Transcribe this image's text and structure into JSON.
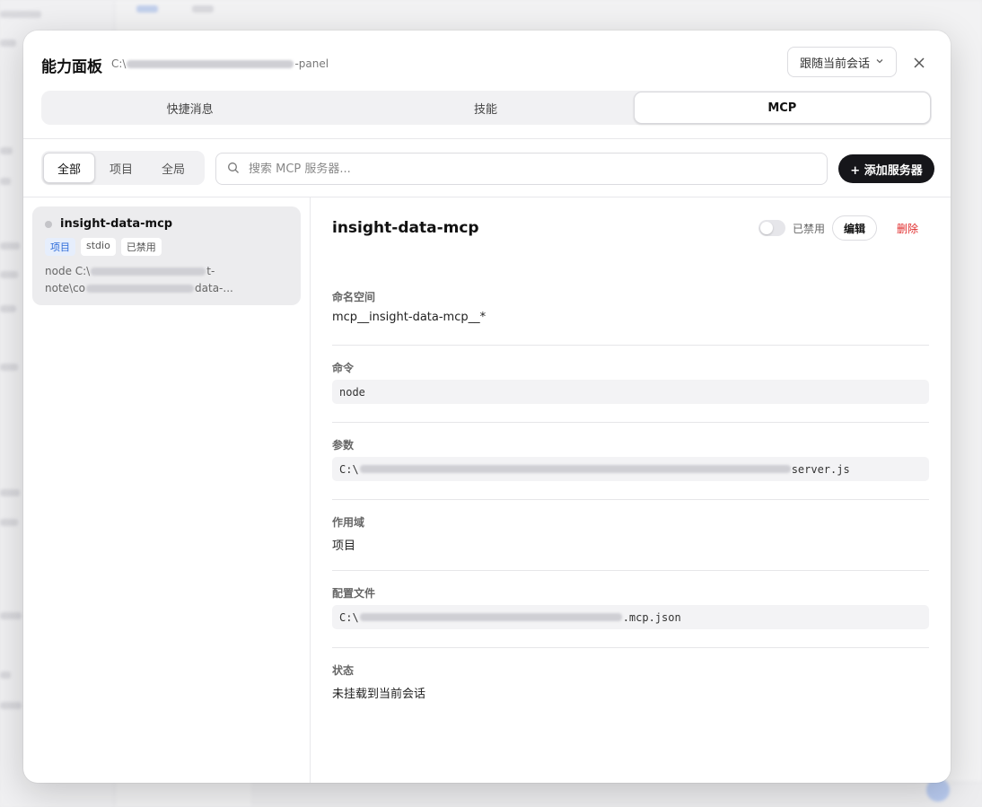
{
  "modal": {
    "title": "能力面板",
    "path_prefix": "C:\\",
    "path_suffix": "-panel",
    "follow_select": "跟随当前会话",
    "close_glyph": "✕"
  },
  "tabs": [
    {
      "label": "快捷消息",
      "active": false
    },
    {
      "label": "技能",
      "active": false
    },
    {
      "label": "MCP",
      "active": true
    }
  ],
  "filter": {
    "segments": [
      "全部",
      "项目",
      "全局"
    ],
    "active": "全部",
    "search_placeholder": "搜索 MCP 服务器...",
    "add_button": "+ 添加服务器"
  },
  "server_list": [
    {
      "name": "insight-data-mcp",
      "badges": [
        "项目",
        "stdio",
        "已禁用"
      ],
      "cmd_line1_prefix": "node C:\\",
      "cmd_line1_suffix": "t-",
      "cmd_line2_prefix": "note\\co",
      "cmd_line2_suffix": "data-..."
    }
  ],
  "detail": {
    "title": "insight-data-mcp",
    "toggle_label": "已禁用",
    "toggle_on": false,
    "edit_button": "编辑",
    "delete_button": "删除",
    "namespace_label": "命名空间",
    "namespace_value": "mcp__insight-data-mcp__*",
    "command_label": "命令",
    "command_value": "node",
    "args_label": "参数",
    "args_prefix": "C:\\",
    "args_suffix": "server.js",
    "scope_label": "作用域",
    "scope_value": "项目",
    "config_label": "配置文件",
    "config_prefix": "C:\\",
    "config_suffix": ".mcp.json",
    "status_label": "状态",
    "status_value": "未挂载到当前会话"
  },
  "colors": {
    "accent_dark": "#16161a",
    "delete_red": "#e02b2b",
    "project_badge": "#2d6bd9"
  },
  "icons": {
    "search": "search-icon",
    "chevron": "chevron-down-icon",
    "close": "close-icon"
  }
}
